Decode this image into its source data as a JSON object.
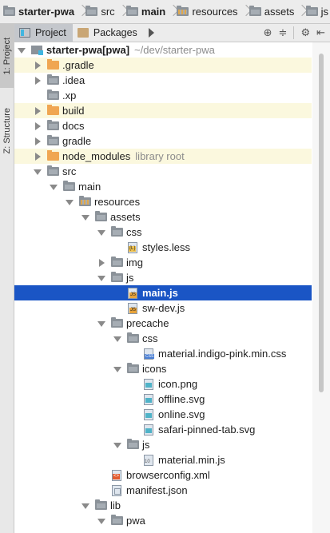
{
  "breadcrumbs": [
    {
      "label": "starter-pwa",
      "bold": true,
      "icon": "module-folder-icon"
    },
    {
      "label": "src",
      "bold": false,
      "icon": "folder-icon"
    },
    {
      "label": "main",
      "bold": true,
      "icon": "folder-icon"
    },
    {
      "label": "resources",
      "bold": false,
      "icon": "resources-folder-icon"
    },
    {
      "label": "assets",
      "bold": false,
      "icon": "folder-icon"
    },
    {
      "label": "js",
      "bold": false,
      "icon": "folder-icon"
    }
  ],
  "side_tabs": {
    "project": "1: Project",
    "structure": "Z: Structure"
  },
  "toolbar": {
    "project_tab": "Project",
    "packages_tab": "Packages"
  },
  "tree": [
    {
      "label": "starter-pwa",
      "suffix": " [pwa]",
      "hint": "~/dev/starter-pwa",
      "depth": 0,
      "arrow": "down",
      "icon": "module",
      "bold": true
    },
    {
      "label": ".gradle",
      "depth": 1,
      "arrow": "right",
      "icon": "orange",
      "excluded": true
    },
    {
      "label": ".idea",
      "depth": 1,
      "arrow": "right",
      "icon": "gray"
    },
    {
      "label": ".xp",
      "depth": 1,
      "arrow": "none",
      "icon": "gray"
    },
    {
      "label": "build",
      "depth": 1,
      "arrow": "right",
      "icon": "orange",
      "excluded": true
    },
    {
      "label": "docs",
      "depth": 1,
      "arrow": "right",
      "icon": "gray"
    },
    {
      "label": "gradle",
      "depth": 1,
      "arrow": "right",
      "icon": "gray"
    },
    {
      "label": "node_modules",
      "hint": "library root",
      "depth": 1,
      "arrow": "right",
      "icon": "orange",
      "excluded": true
    },
    {
      "label": "src",
      "depth": 1,
      "arrow": "down",
      "icon": "gray"
    },
    {
      "label": "main",
      "depth": 2,
      "arrow": "down",
      "icon": "blue"
    },
    {
      "label": "resources",
      "depth": 3,
      "arrow": "down",
      "icon": "res"
    },
    {
      "label": "assets",
      "depth": 4,
      "arrow": "down",
      "icon": "gray"
    },
    {
      "label": "css",
      "depth": 5,
      "arrow": "down",
      "icon": "gray"
    },
    {
      "label": "styles.less",
      "depth": 6,
      "arrow": "none",
      "icon": "less"
    },
    {
      "label": "img",
      "depth": 5,
      "arrow": "right",
      "icon": "gray"
    },
    {
      "label": "js",
      "depth": 5,
      "arrow": "down",
      "icon": "gray"
    },
    {
      "label": "main.js",
      "depth": 6,
      "arrow": "none",
      "icon": "js",
      "selected": true
    },
    {
      "label": "sw-dev.js",
      "depth": 6,
      "arrow": "none",
      "icon": "js"
    },
    {
      "label": "precache",
      "depth": 5,
      "arrow": "down",
      "icon": "gray"
    },
    {
      "label": "css",
      "depth": 6,
      "arrow": "down",
      "icon": "gray"
    },
    {
      "label": "material.indigo-pink.min.css",
      "depth": 7,
      "arrow": "none",
      "icon": "css"
    },
    {
      "label": "icons",
      "depth": 6,
      "arrow": "down",
      "icon": "gray"
    },
    {
      "label": "icon.png",
      "depth": 7,
      "arrow": "none",
      "icon": "img"
    },
    {
      "label": "offline.svg",
      "depth": 7,
      "arrow": "none",
      "icon": "img"
    },
    {
      "label": "online.svg",
      "depth": 7,
      "arrow": "none",
      "icon": "img"
    },
    {
      "label": "safari-pinned-tab.svg",
      "depth": 7,
      "arrow": "none",
      "icon": "img"
    },
    {
      "label": "js",
      "depth": 6,
      "arrow": "down",
      "icon": "gray"
    },
    {
      "label": "material.min.js",
      "depth": 7,
      "arrow": "none",
      "icon": "min"
    },
    {
      "label": "browserconfig.xml",
      "depth": 5,
      "arrow": "none",
      "icon": "xml"
    },
    {
      "label": "manifest.json",
      "depth": 5,
      "arrow": "none",
      "icon": "json"
    },
    {
      "label": "lib",
      "depth": 4,
      "arrow": "down",
      "icon": "gray"
    },
    {
      "label": "pwa",
      "depth": 5,
      "arrow": "down",
      "icon": "gray"
    }
  ]
}
